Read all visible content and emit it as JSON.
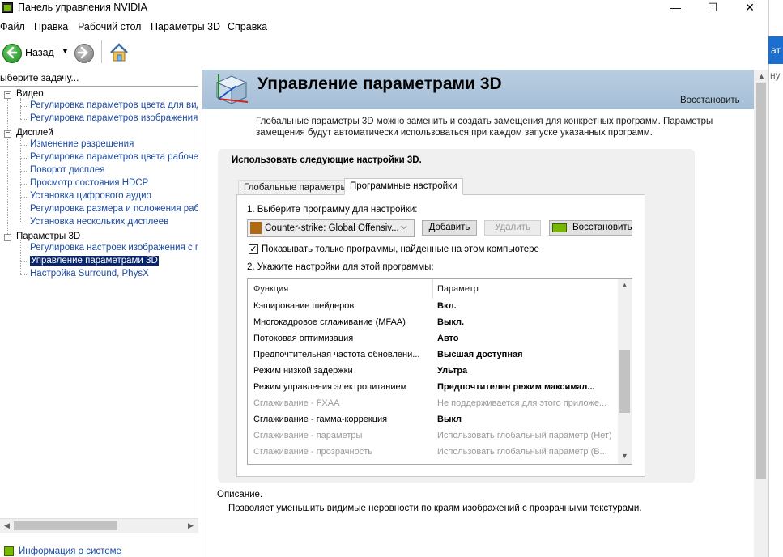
{
  "window": {
    "title": "Панель управления NVIDIA",
    "min_glyph": "—",
    "max_glyph": "☐",
    "close_glyph": "✕"
  },
  "menu": [
    "Файл",
    "Правка",
    "Рабочий стол",
    "Параметры 3D",
    "Справка"
  ],
  "toolbar": {
    "back_label": "Назад",
    "back_icon": "arrow-left-icon",
    "forward_icon": "arrow-right-icon",
    "home_icon": "home-icon"
  },
  "side": {
    "task_label": "ыберите задачу...",
    "categories": [
      {
        "label": "Видео",
        "items": [
          "Регулировка параметров цвета для вид",
          "Регулировка параметров изображения д"
        ]
      },
      {
        "label": "Дисплей",
        "items": [
          "Изменение разрешения",
          "Регулировка параметров цвета рабочег",
          "Поворот дисплея",
          "Просмотр состояния HDCP",
          "Установка цифрового аудио",
          "Регулировка размера и положения рабо",
          "Установка нескольких дисплеев"
        ]
      },
      {
        "label": "Параметры 3D",
        "items": [
          "Регулировка настроек изображения с пр",
          "Управление параметрами 3D",
          "Настройка Surround, PhysX"
        ]
      }
    ],
    "selected_item": "Управление параметрами 3D",
    "system_info": "Информация о системе"
  },
  "main": {
    "title": "Управление параметрами 3D",
    "restore_link": "Восстановить",
    "intro": "Глобальные параметры 3D можно заменить и создать замещения для конкретных программ. Параметры замещения будут автоматически использоваться при каждом запуске указанных программ.",
    "card_title": "Использовать следующие настройки 3D.",
    "tabs": [
      "Глобальные параметры",
      "Программные настройки"
    ],
    "active_tab": "Программные настройки",
    "step1": "1. Выберите программу для настройки:",
    "program": "Counter-strike: Global Offensiv...",
    "buttons": {
      "add": "Добавить",
      "delete": "Удалить",
      "restore": "Восстановить"
    },
    "checkbox_label": "Показывать только программы, найденные на этом компьютере",
    "checkbox_checked": true,
    "step2": "2. Укажите настройки для этой программы:",
    "grid": {
      "headers": [
        "Функция",
        "Параметр"
      ],
      "rows": [
        {
          "func": "Кэширование шейдеров",
          "value": "Вкл.",
          "enabled": true
        },
        {
          "func": "Многокадровое сглаживание (MFAA)",
          "value": "Выкл.",
          "enabled": true
        },
        {
          "func": "Потоковая оптимизация",
          "value": "Авто",
          "enabled": true
        },
        {
          "func": "Предпочтительная частота обновлени...",
          "value": "Высшая доступная",
          "enabled": true
        },
        {
          "func": "Режим низкой задержки",
          "value": "Ультра",
          "enabled": true
        },
        {
          "func": "Режим управления электропитанием",
          "value": "Предпочтителен режим максимал...",
          "enabled": true
        },
        {
          "func": "Сглаживание - FXAA",
          "value": "Не поддерживается для этого приложе...",
          "enabled": false
        },
        {
          "func": "Сглаживание - гамма-коррекция",
          "value": "Выкл",
          "enabled": true
        },
        {
          "func": "Сглаживание - параметры",
          "value": "Использовать глобальный параметр (Нет)",
          "enabled": false
        },
        {
          "func": "Сглаживание - прозрачность",
          "value": "Использовать глобальный параметр (В...",
          "enabled": false
        }
      ]
    },
    "desc_title": "Описание.",
    "desc_text": "Позволяет уменьшить видимые неровности по краям изображений с прозрачными текстурами."
  },
  "external": {
    "blue_button": "ат",
    "side_text": "ну"
  },
  "colors": {
    "nvidia_green": "#76b900",
    "banner": "#a5bfd8",
    "link": "#1c4ba3",
    "selection": "#0a246a"
  }
}
